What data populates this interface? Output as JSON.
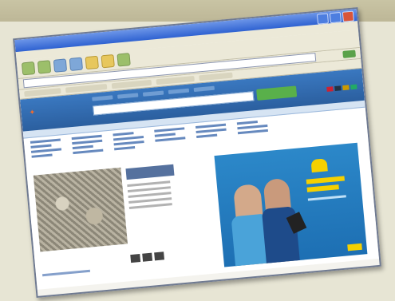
{
  "screenshot": {
    "window": {
      "title": ""
    },
    "menu": [],
    "site": {
      "logo": "",
      "search_button": ""
    }
  },
  "colors": {
    "background": "#e7e5d4",
    "window_title_bar": "#2f62d1",
    "site_header": "#2b5f9f",
    "search_button": "#59b04a",
    "ad_background": "#1d6fb3",
    "ad_accent": "#f5d000"
  }
}
